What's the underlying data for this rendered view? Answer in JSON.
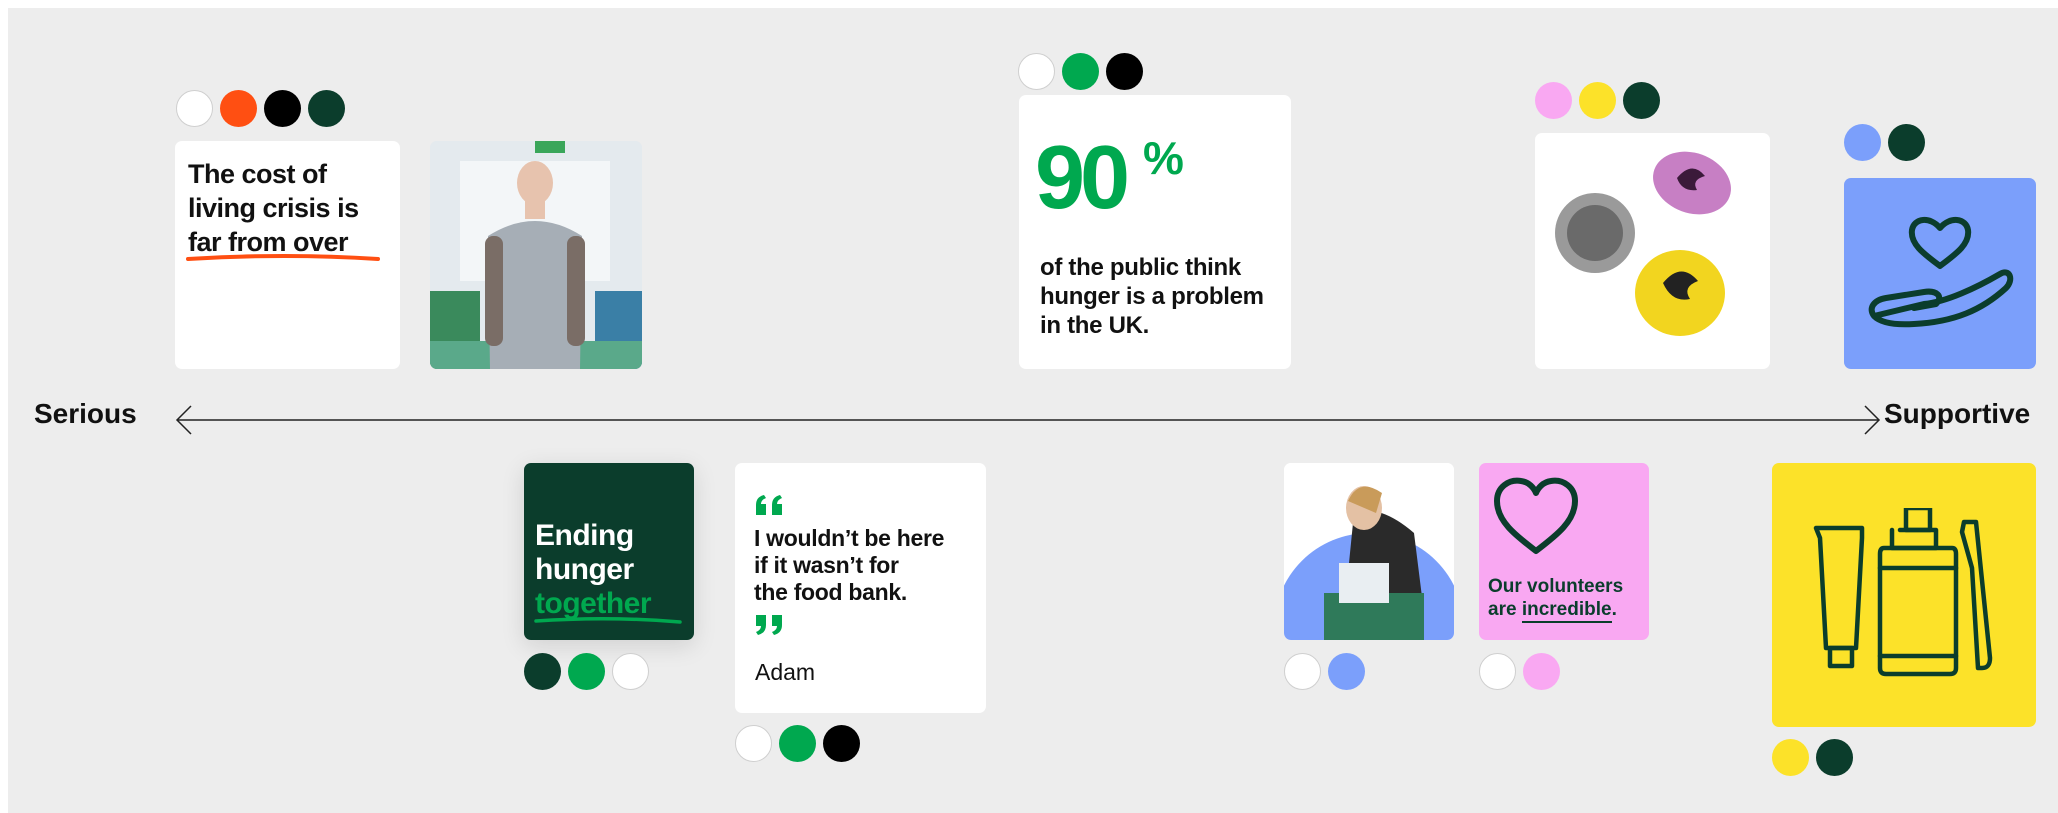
{
  "axis": {
    "left_label": "Serious",
    "right_label": "Supportive"
  },
  "colors": {
    "white": "#ffffff",
    "orange": "#ff4f12",
    "black": "#000000",
    "dark_green": "#0b3d2c",
    "green": "#00a84f",
    "pink": "#f9a8f2",
    "yellow": "#fce229",
    "blue": "#7b9ffb",
    "canvas": "#ededed"
  },
  "cards": {
    "cost_of_living": {
      "line1": "The cost of",
      "line2": "living crisis is",
      "line3": "far from over",
      "swatches": [
        "white",
        "orange",
        "black",
        "dark_green"
      ]
    },
    "man_photo": {
      "swatches": []
    },
    "stat": {
      "number": "90",
      "percent": "%",
      "line1": "of the public think",
      "line2": "hunger is a problem",
      "line3": "in the UK.",
      "swatches": [
        "white",
        "green",
        "black"
      ]
    },
    "badges": {
      "swatches": [
        "pink",
        "yellow",
        "dark_green"
      ]
    },
    "heart_hand": {
      "icon": "heart-in-hand-icon",
      "swatches": [
        "blue",
        "dark_green"
      ]
    },
    "ending_hunger": {
      "line1": "Ending",
      "line2": "hunger",
      "line3": "together",
      "swatches": [
        "dark_green",
        "green",
        "white"
      ]
    },
    "quote": {
      "line1": "I wouldn’t be here",
      "line2": "if it wasn’t for",
      "line3": "the food bank.",
      "author": "Adam",
      "swatches": [
        "white",
        "green",
        "black"
      ]
    },
    "volunteer_photo": {
      "swatches": [
        "white",
        "blue"
      ]
    },
    "volunteers": {
      "line1": "Our volunteers",
      "line2_prefix": "are ",
      "line2_emph": "incredible",
      "line2_suffix": ".",
      "swatches": [
        "white",
        "pink"
      ]
    },
    "toiletries": {
      "icon": "toiletries-icon",
      "swatches": [
        "yellow",
        "dark_green"
      ]
    }
  }
}
